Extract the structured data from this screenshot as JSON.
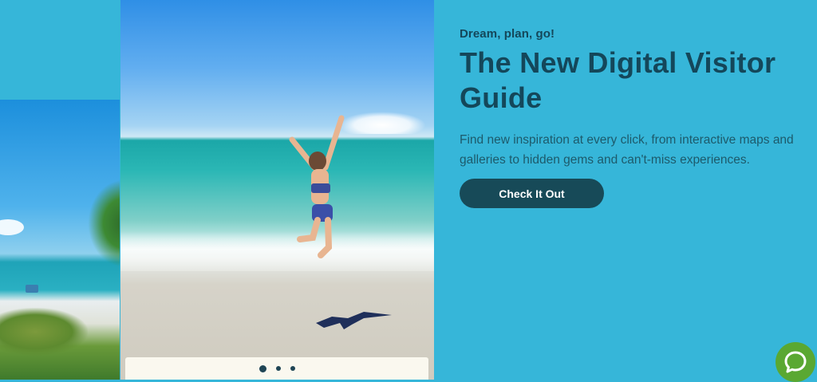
{
  "hero": {
    "eyebrow": "Dream, plan, go!",
    "title": "The New Digital Visitor Guide",
    "description": "Find new inspiration at every click, from interactive maps and galleries to hidden gems and can't-miss experiences.",
    "cta_label": "Check It Out"
  },
  "carousel": {
    "slide_count": 3,
    "active_index": 0
  },
  "icons": {
    "chat": "chat-bubble-icon"
  },
  "colors": {
    "background": "#36b6d9",
    "heading": "#14475a",
    "button": "#174a58",
    "chat": "#5aa832"
  }
}
